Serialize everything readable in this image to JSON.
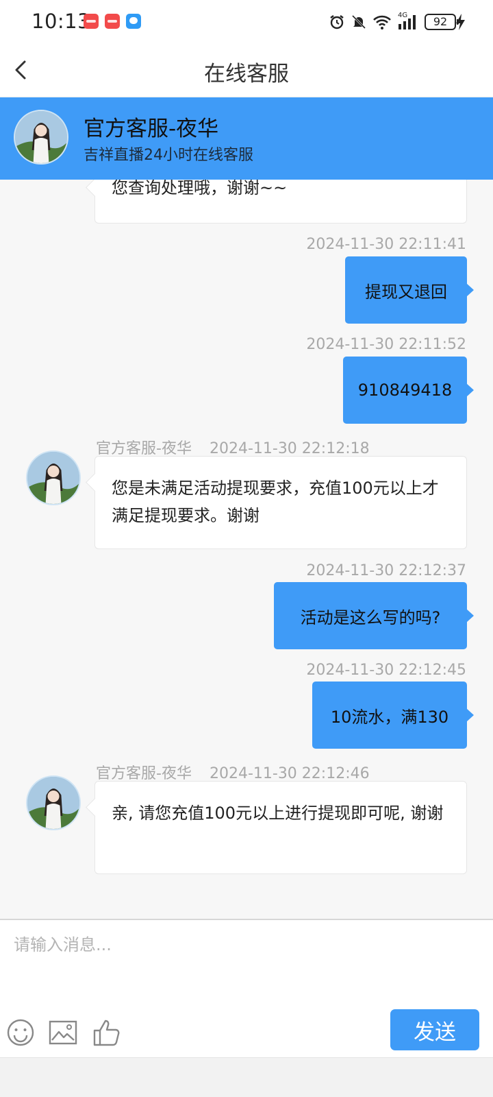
{
  "status_bar": {
    "time": "10:13",
    "network": "4G",
    "battery": "92"
  },
  "nav": {
    "title": "在线客服"
  },
  "agent": {
    "name": "官方客服-夜华",
    "description": "吉祥直播24小时在线客服"
  },
  "messages": [
    {
      "from": "agent",
      "text": "您查询处理哦，谢谢~~"
    },
    {
      "from": "user",
      "time": "2024-11-30 22:11:41",
      "text": "提现又退回"
    },
    {
      "from": "user",
      "time": "2024-11-30 22:11:52",
      "text": "910849418"
    },
    {
      "from": "agent",
      "sender": "官方客服-夜华",
      "time": "2024-11-30 22:12:18",
      "text": "您是未满足活动提现要求，充值100元以上才满足提现要求。谢谢"
    },
    {
      "from": "user",
      "time": "2024-11-30 22:12:37",
      "text": "活动是这么写的吗?"
    },
    {
      "from": "user",
      "time": "2024-11-30 22:12:45",
      "text": "10流水，满130"
    },
    {
      "from": "agent",
      "sender": "官方客服-夜华",
      "time": "2024-11-30 22:12:46",
      "text": "亲, 请您充值100元以上进行提现即可呢, 谢谢"
    }
  ],
  "composer": {
    "placeholder": "请输入消息...",
    "send_label": "发送",
    "icons": [
      "emoji-icon",
      "image-icon",
      "thumbs-up-icon"
    ]
  },
  "colors": {
    "accent": "#3f9bf7",
    "background": "#f7f7f7",
    "timestamp": "#a8a8a8"
  }
}
